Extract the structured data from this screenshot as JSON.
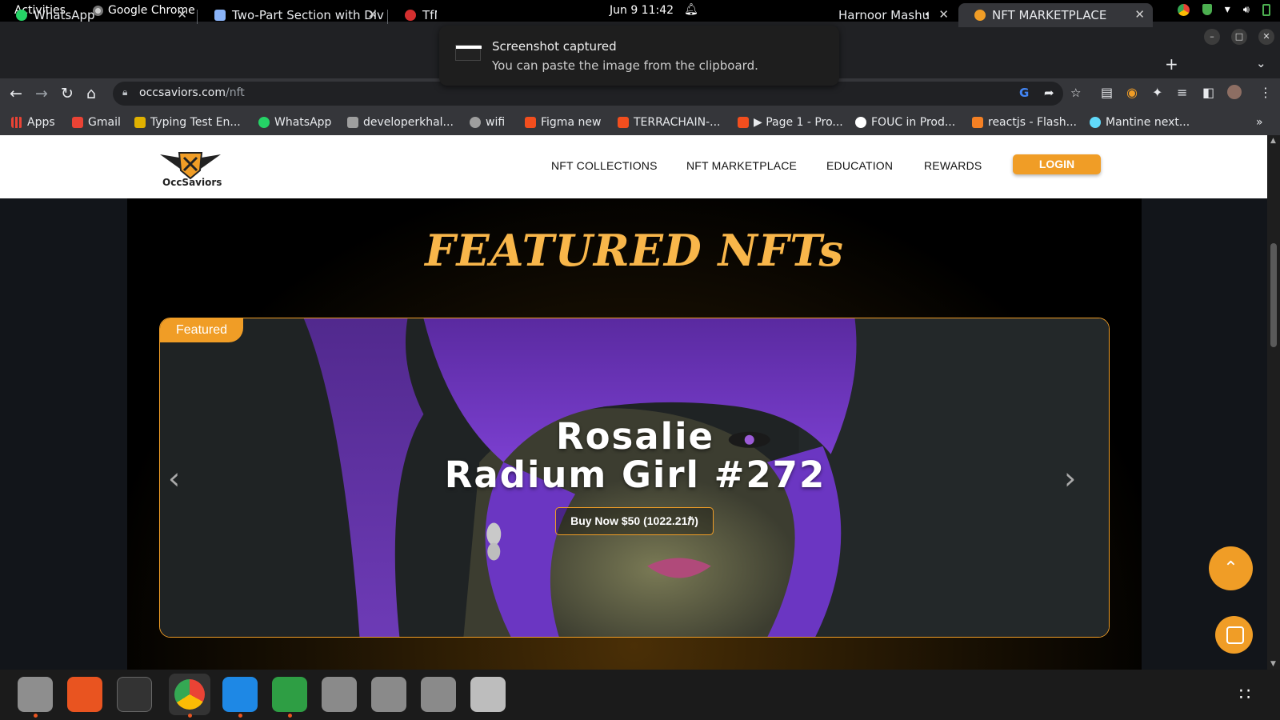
{
  "system": {
    "activities": "Activities",
    "app_name": "Google Chrome",
    "clock": "Jun 9  11:42"
  },
  "toast": {
    "title": "Screenshot captured",
    "message": "You can paste the image from the clipboard."
  },
  "tabs": [
    {
      "title": "WhatsApp",
      "favicon_color": "#25d366"
    },
    {
      "title": "Two-Part Section with Div",
      "favicon_color": "#8ab4f8"
    },
    {
      "title": "TfN",
      "favicon_color": "#d32f2f"
    },
    {
      "title": "Harnoor Mashu",
      "favicon_color": "#888888"
    },
    {
      "title": "NFT MARKETPLACE",
      "favicon_color": "#f09d26",
      "active": true
    }
  ],
  "omnibox": {
    "domain": "occsaviors.com",
    "path": "/nft"
  },
  "bookmarks": [
    {
      "label": "Apps",
      "color": "#ea4335"
    },
    {
      "label": "Gmail",
      "color": "#ea4335"
    },
    {
      "label": "Typing Test En...",
      "color": "#e0b100"
    },
    {
      "label": "WhatsApp",
      "color": "#25d366"
    },
    {
      "label": "developerkhal...",
      "color": "#9e9e9e"
    },
    {
      "label": "wifi",
      "color": "#9e9e9e"
    },
    {
      "label": "Figma new",
      "color": "#f24e1e"
    },
    {
      "label": "TERRACHAIN-...",
      "color": "#f24e1e"
    },
    {
      "label": "▶ Page 1 - Pro...",
      "color": "#f24e1e"
    },
    {
      "label": "FOUC in Prod...",
      "color": "#ffffff"
    },
    {
      "label": "reactjs - Flash...",
      "color": "#f48024"
    },
    {
      "label": "Mantine next...",
      "color": "#61dafb"
    }
  ],
  "site": {
    "logo_text": "OccSaviors",
    "nav": [
      "NFT COLLECTIONS",
      "NFT MARKETPLACE",
      "EDUCATION",
      "REWARDS"
    ],
    "login": "LOGIN",
    "featured_title": "FEATURED NFTs",
    "badge": "Featured",
    "nft_line1": "Rosalie",
    "nft_line2": "Radium Girl #272",
    "buy_button": "Buy Now $50 (1022.21ℏ)"
  },
  "colors": {
    "accent": "#f09d26",
    "title_gold": "#f8b64a",
    "hair_purple": "#7b3fd0"
  },
  "icons": [
    "bell-icon",
    "chrome-icon",
    "shield-icon",
    "wifi-icon",
    "volume-icon",
    "battery-icon",
    "back-icon",
    "forward-icon",
    "reload-icon",
    "home-icon",
    "lock-icon",
    "share-icon",
    "star-icon",
    "extensions-icon",
    "chevron-left-icon",
    "chevron-right-icon",
    "chevron-up-icon",
    "chat-icon"
  ]
}
